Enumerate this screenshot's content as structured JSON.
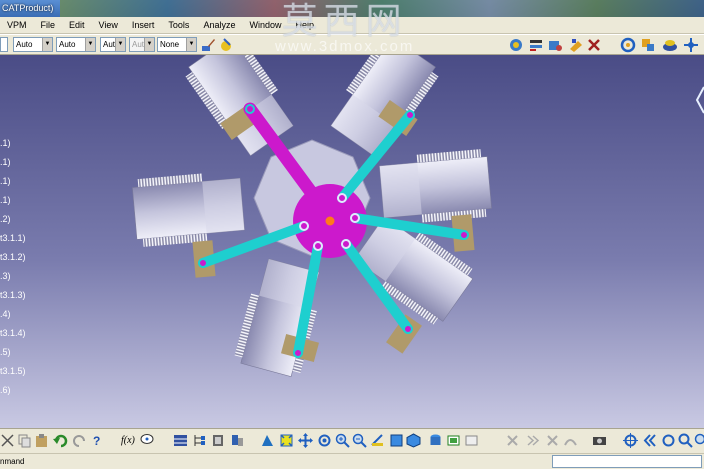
{
  "window": {
    "title": "CATProduct)"
  },
  "watermark": {
    "text": "莫西网",
    "url": "www.3dmox.com"
  },
  "menu": [
    "VPM",
    "File",
    "Edit",
    "View",
    "Insert",
    "Tools",
    "Analyze",
    "Window",
    "Help"
  ],
  "toolbar": {
    "combos": [
      {
        "value": "Auto",
        "disabled": false
      },
      {
        "value": "Auto",
        "disabled": false
      },
      {
        "value": "Aut",
        "disabled": false
      },
      {
        "value": "Aut",
        "disabled": true
      },
      {
        "value": "None",
        "disabled": false
      }
    ],
    "icons": [
      "paint-brush-icon",
      "multi-view-icon",
      "spec-icon",
      "sketch-icon",
      "measure-icon",
      "catalog-icon",
      "rotate-icon",
      "gear-icon",
      "drive-icon",
      "compass-icon"
    ]
  },
  "tree": {
    "items": [
      ".1)",
      ".1)",
      ".1)",
      ".1)",
      ".2)",
      "t3.1.1)",
      "t3.1.2)",
      ".3)",
      "t3.1.3)",
      ".4)",
      "t3.1.4)",
      ".5)",
      "t3.1.5)",
      ".6)"
    ]
  },
  "scene": {
    "colors": {
      "crank": "#cc19cc",
      "rods": "#1ecfcf",
      "center_pin": "#ff7a1a",
      "engine_body": "#c8c8e0",
      "piston": "#b09a6a"
    }
  },
  "bottom_toolbar": {
    "formula_label": "f(x)",
    "icons": [
      "cut-icon",
      "copy-icon",
      "paste-icon",
      "undo-icon",
      "redo-icon",
      "help-icon",
      "formula-icon",
      "comment-icon",
      "table-icon",
      "tree-icon",
      "catalog-icon",
      "clash-icon",
      "fit-all-icon",
      "pan-icon",
      "rotate-icon",
      "zoom-in-icon",
      "zoom-out-icon",
      "normal-view-icon",
      "iso-view-icon",
      "cube-icon",
      "shading-icon",
      "hide-show-icon",
      "swap-icon",
      "snap-icon",
      "camera-icon",
      "target-icon",
      "arrows-icon",
      "search-icon"
    ]
  },
  "status": {
    "command_label": "nmand",
    "command_value": ""
  }
}
